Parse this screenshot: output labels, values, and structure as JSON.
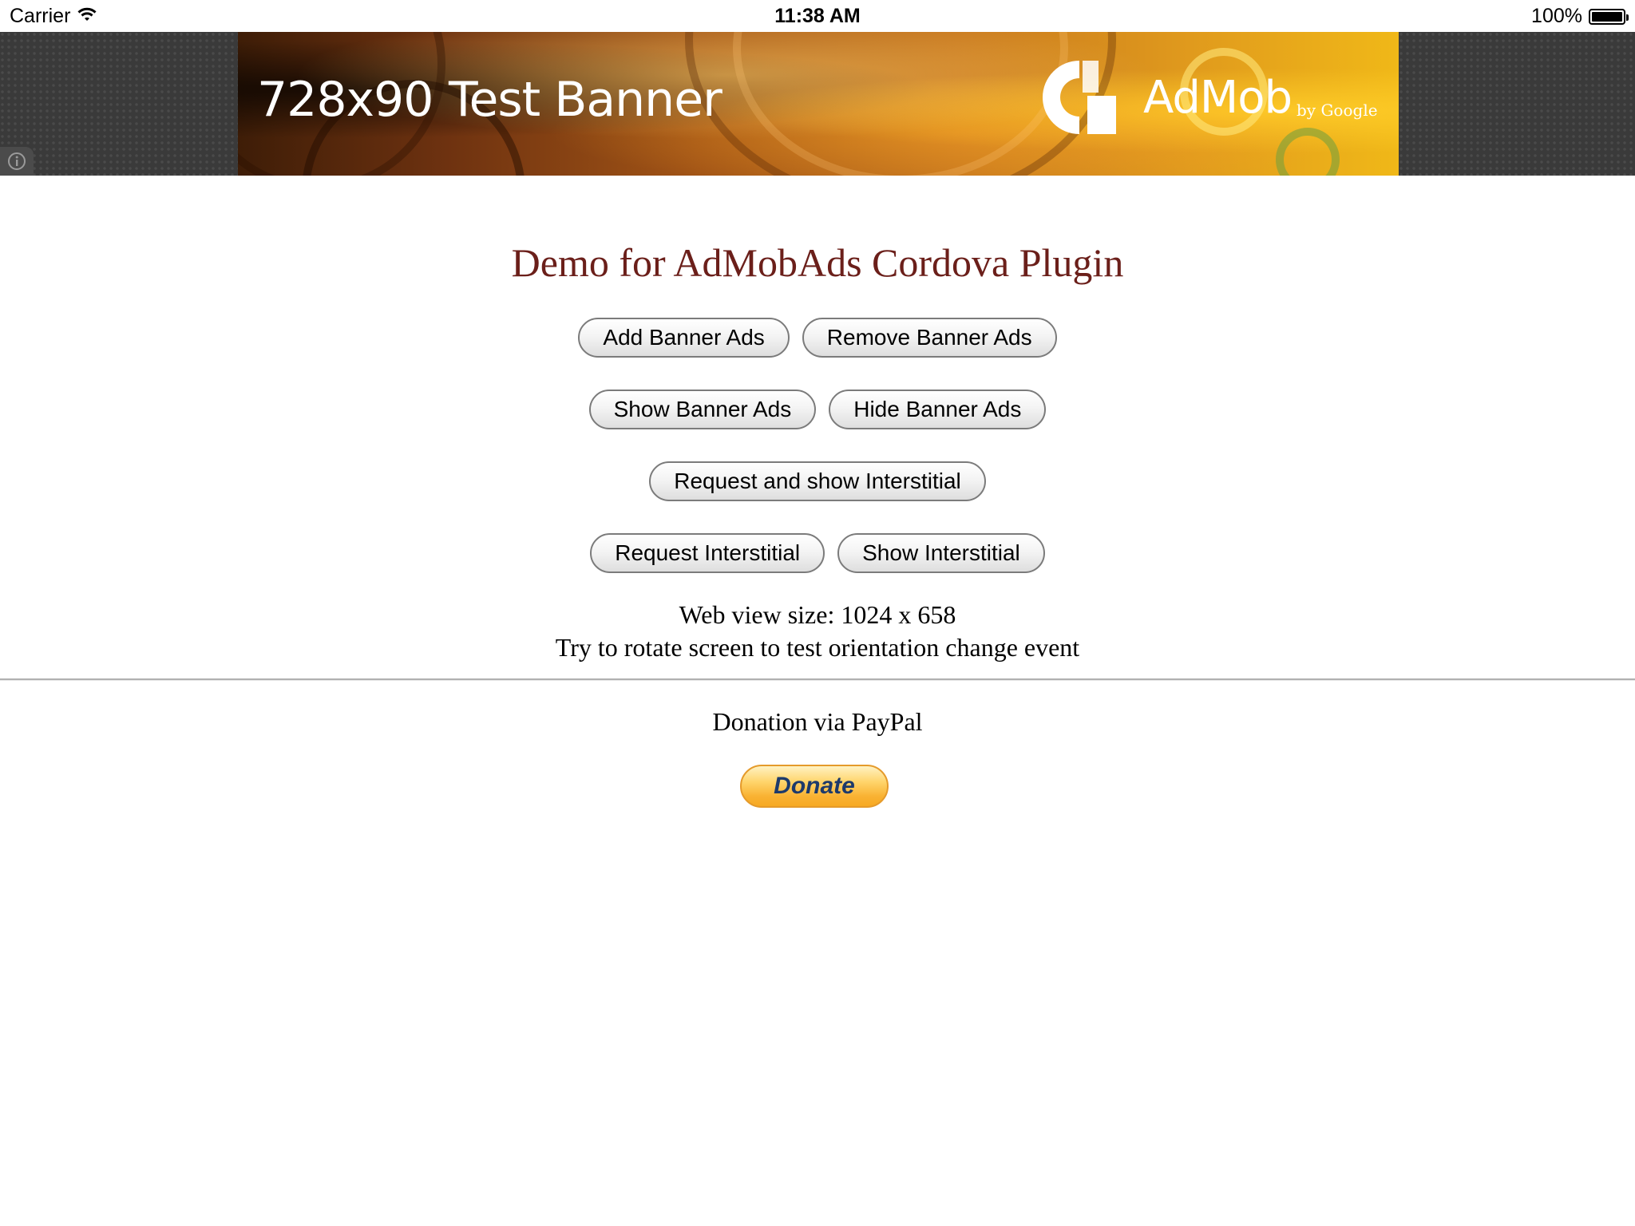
{
  "status_bar": {
    "carrier": "Carrier",
    "time": "11:38 AM",
    "battery": "100%"
  },
  "ad_banner": {
    "size_text": "728x90",
    "title_text": "Test Banner",
    "brand": "AdMob",
    "brand_by": "by Google",
    "info_icon": "info-icon"
  },
  "page": {
    "title": "Demo for AdMobAds Cordova Plugin",
    "title_color": "#6b1f1a",
    "buttons": {
      "add_banner": "Add Banner Ads",
      "remove_banner": "Remove Banner Ads",
      "show_banner": "Show Banner Ads",
      "hide_banner": "Hide Banner Ads",
      "request_show_interstitial": "Request and show Interstitial",
      "request_interstitial": "Request Interstitial",
      "show_interstitial": "Show Interstitial"
    },
    "web_view_size": "Web view size: 1024 x 658",
    "rotate_hint": "Try to rotate screen to test orientation change event",
    "donation_label": "Donation via PayPal",
    "donate_button": "Donate"
  }
}
